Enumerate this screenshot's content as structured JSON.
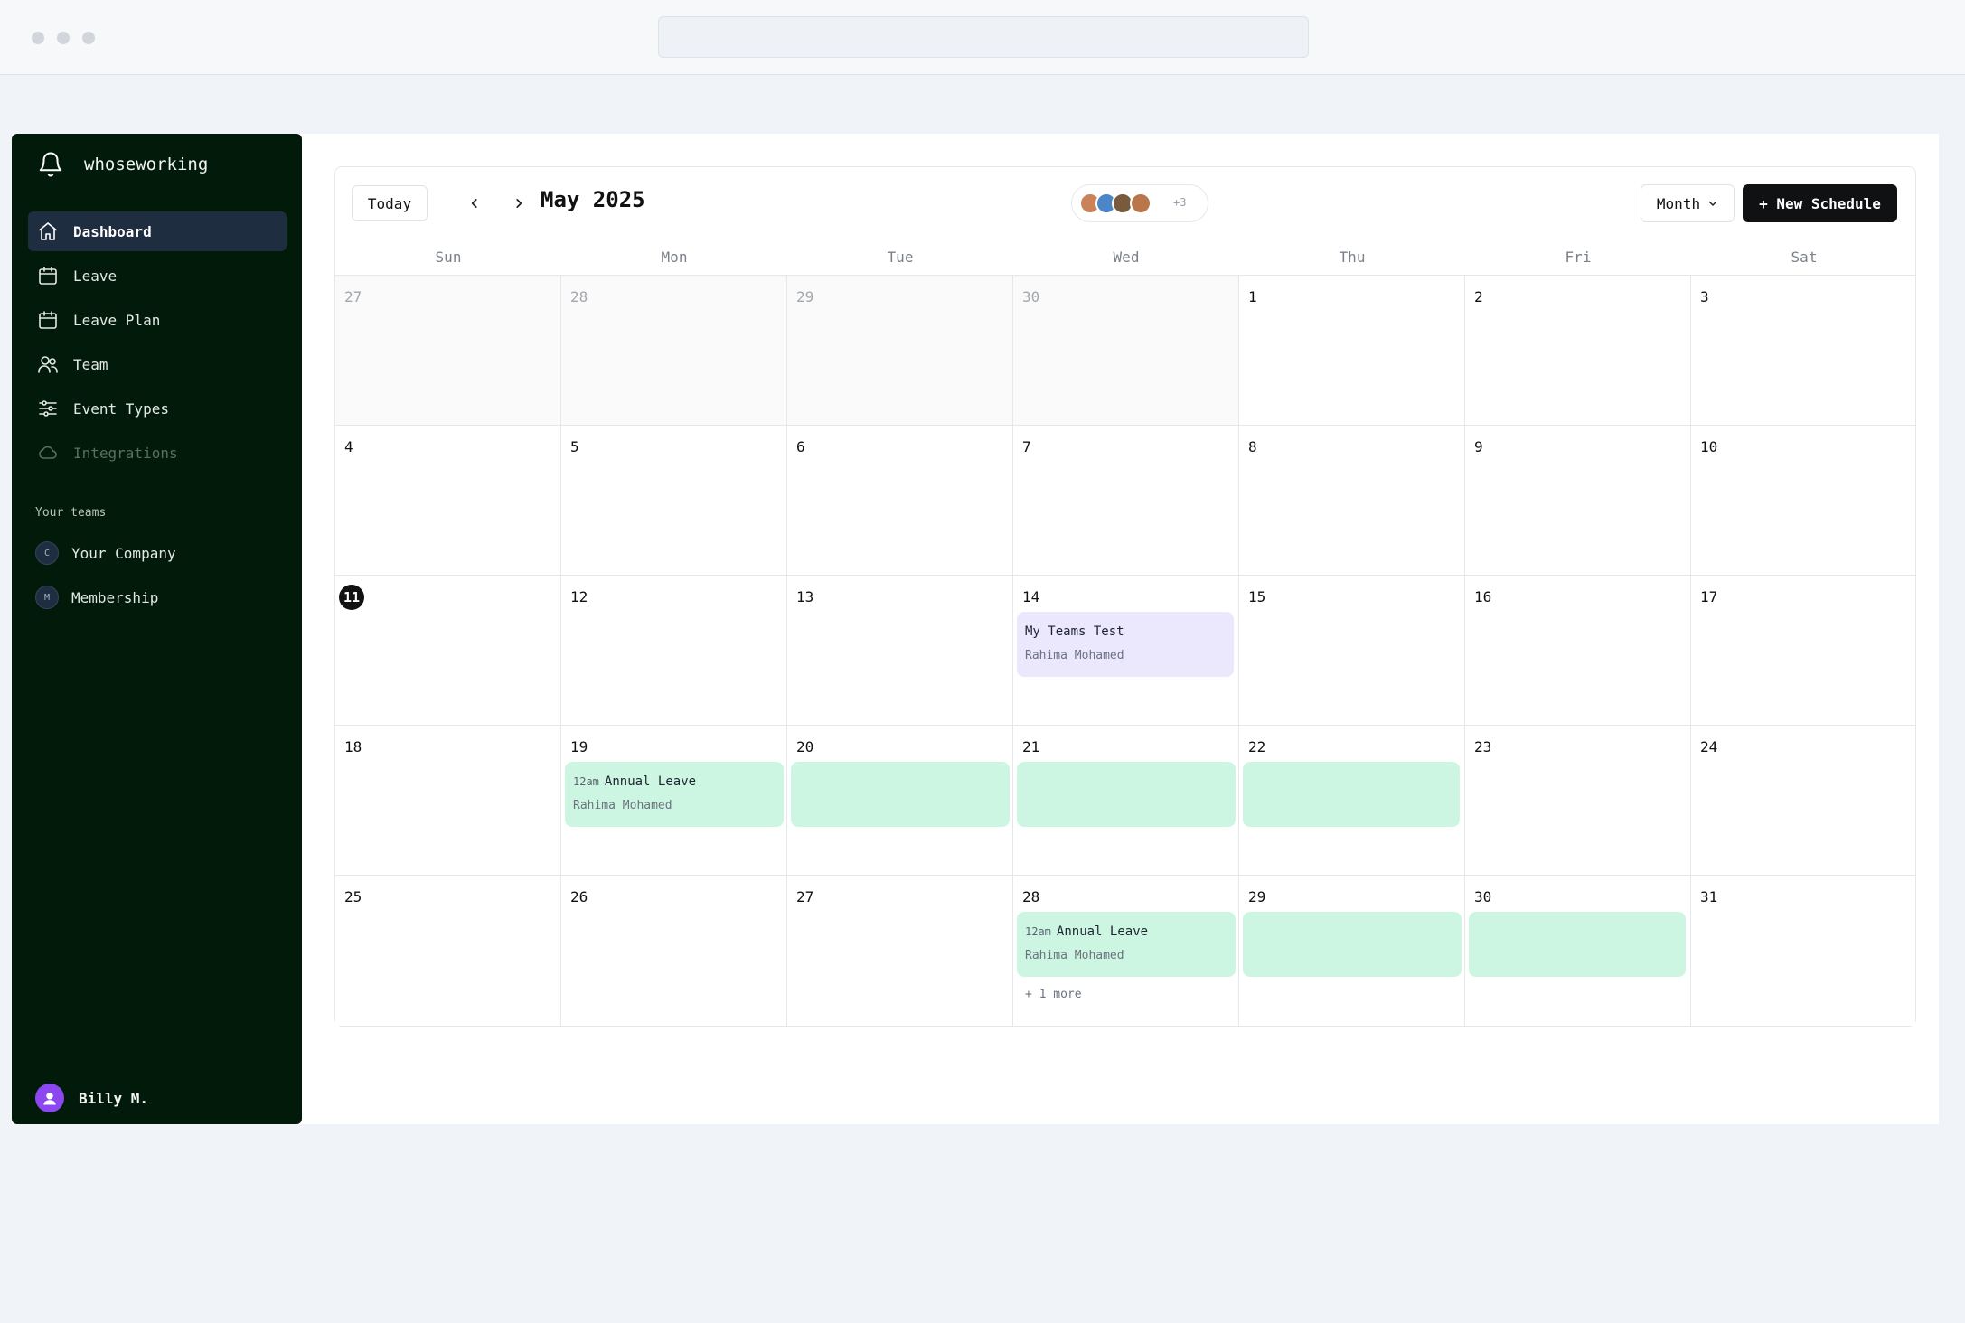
{
  "app": {
    "name": "whoseworking"
  },
  "sidebar": {
    "nav": [
      {
        "label": "Dashboard",
        "icon": "home-icon",
        "active": true
      },
      {
        "label": "Leave",
        "icon": "calendar-icon"
      },
      {
        "label": "Leave Plan",
        "icon": "calendar-icon"
      },
      {
        "label": "Team",
        "icon": "users-icon"
      },
      {
        "label": "Event Types",
        "icon": "sliders-icon"
      },
      {
        "label": "Integrations",
        "icon": "cloud-icon",
        "disabled": true
      }
    ],
    "teams_label": "Your teams",
    "teams": [
      {
        "initial": "C",
        "label": "Your Company"
      },
      {
        "initial": "M",
        "label": "Membership"
      }
    ],
    "user": {
      "name": "Billy M."
    }
  },
  "calendar": {
    "today_label": "Today",
    "prev_label": "‹",
    "next_label": "›",
    "title": "May 2025",
    "extra_members": "+3",
    "view_label": "Month",
    "new_label": "+ New Schedule",
    "weekdays": [
      "Sun",
      "Mon",
      "Tue",
      "Wed",
      "Thu",
      "Fri",
      "Sat"
    ],
    "weeks": [
      [
        "27",
        "28",
        "29",
        "30",
        "1",
        "2",
        "3"
      ],
      [
        "4",
        "5",
        "6",
        "7",
        "8",
        "9",
        "10"
      ],
      [
        "11",
        "12",
        "13",
        "14",
        "15",
        "16",
        "17"
      ],
      [
        "18",
        "19",
        "20",
        "21",
        "22",
        "23",
        "24"
      ],
      [
        "25",
        "26",
        "27",
        "28",
        "29",
        "30",
        "31"
      ]
    ],
    "today_date": "11",
    "events": {
      "teams_test": {
        "title": "My Teams Test",
        "person": "Rahima Mohamed"
      },
      "leave1": {
        "time": "12am",
        "title": "Annual Leave",
        "person": "Rahima Mohamed"
      },
      "leave2": {
        "time": "12am",
        "title": "Annual Leave",
        "person": "Rahima Mohamed"
      }
    },
    "more_link": "+ 1 more"
  },
  "colors": {
    "sidebar": "#021a09",
    "event_purple": "#ebe7fd",
    "event_green": "#cdf6e2",
    "primary_button": "#0f1113"
  }
}
